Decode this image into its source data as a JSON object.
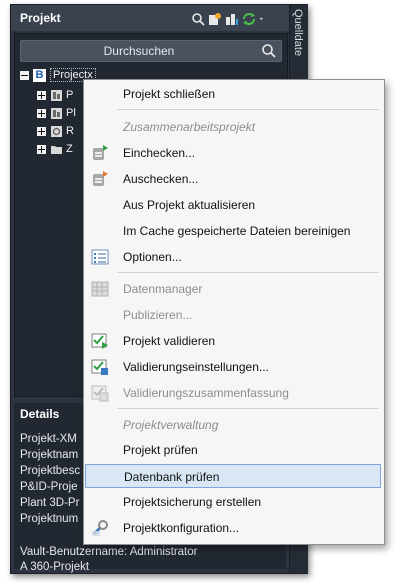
{
  "palette": {
    "title": "Projekt",
    "side_tab": "Quelldate",
    "search_placeholder": "Durchsuchen",
    "tree": {
      "root_badge": "B",
      "root_label": "Projectx",
      "children": [
        {
          "label": "P",
          "icon": "plant-folder-icon"
        },
        {
          "label": "Pl",
          "icon": "plant-folder-icon"
        },
        {
          "label": "R",
          "icon": "report-icon"
        },
        {
          "label": "Z",
          "icon": "drawing-folder-icon"
        }
      ]
    },
    "details": {
      "title": "Details",
      "lines": [
        "Projekt-XM",
        "Projektnam",
        "Projektbesc",
        "P&ID-Proje",
        "Plant 3D-Pr",
        "Projektnum",
        "Vault-Benutzername:  Administrator",
        "A 360-Projekt"
      ]
    }
  },
  "context_menu": {
    "items": [
      {
        "label": "Projekt schließen",
        "enabled": true
      },
      {
        "label": "Einchecken...",
        "enabled": true,
        "icon": "checkin-icon"
      },
      {
        "label": "Auschecken...",
        "enabled": true,
        "icon": "checkout-icon"
      },
      {
        "label": "Aus Projekt aktualisieren",
        "enabled": true
      },
      {
        "label": "Im Cache gespeicherte Dateien bereinigen",
        "enabled": true
      },
      {
        "label": "Optionen...",
        "enabled": true,
        "icon": "options-icon"
      },
      {
        "label": "Datenmanager",
        "enabled": false,
        "icon": "data-manager-icon"
      },
      {
        "label": "Publizieren...",
        "enabled": false
      },
      {
        "label": "Projekt validieren",
        "enabled": true,
        "icon": "validate-icon"
      },
      {
        "label": "Validierungseinstellungen...",
        "enabled": true,
        "icon": "validation-settings-icon"
      },
      {
        "label": "Validierungszusammenfassung",
        "enabled": false,
        "icon": "validation-summary-icon"
      },
      {
        "label": "Projekt prüfen",
        "enabled": true
      },
      {
        "label": "Datenbank prüfen",
        "enabled": true,
        "highlighted": true
      },
      {
        "label": "Projektsicherung erstellen",
        "enabled": true
      },
      {
        "label": "Projektkonfiguration...",
        "enabled": true,
        "icon": "project-config-icon"
      }
    ],
    "sections": {
      "collaboration": "Zusammenarbeitsprojekt",
      "management": "Projektverwaltung"
    }
  },
  "colors": {
    "palette_bg": "#2d3440",
    "menu_bg": "#f6f6f6",
    "highlight_bg": "#d8e6f6",
    "highlight_border": "#7da7d8",
    "disabled_text": "#8d8d8d"
  }
}
